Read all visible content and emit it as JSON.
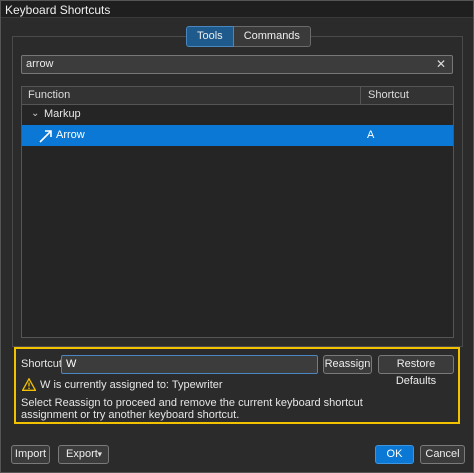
{
  "window": {
    "title": "Keyboard Shortcuts"
  },
  "tabs": [
    {
      "label": "Tools",
      "active": true
    },
    {
      "label": "Commands",
      "active": false
    }
  ],
  "search": {
    "value": "arrow",
    "clear_icon": "close-icon"
  },
  "table": {
    "headers": [
      "Function",
      "Shortcut"
    ],
    "group": {
      "label": "Markup",
      "expanded": true
    },
    "rows": [
      {
        "function": "Arrow",
        "shortcut": "A",
        "icon": "arrow-tool-icon",
        "selected": true
      }
    ]
  },
  "reassign": {
    "shortcut_label": "Shortcut:",
    "shortcut_value": "W",
    "reassign_label": "Reassign",
    "restore_label": "Restore Defaults",
    "warning": "W is currently assigned to: Typewriter",
    "info": "Select Reassign to proceed and remove the current keyboard shortcut assignment or try another keyboard shortcut.",
    "highlight_color": "#f2c200"
  },
  "footer": {
    "import_label": "Import",
    "export_label": "Export",
    "ok_label": "OK",
    "cancel_label": "Cancel"
  },
  "colors": {
    "accent": "#0a78d4",
    "background": "#2b2b2b"
  }
}
